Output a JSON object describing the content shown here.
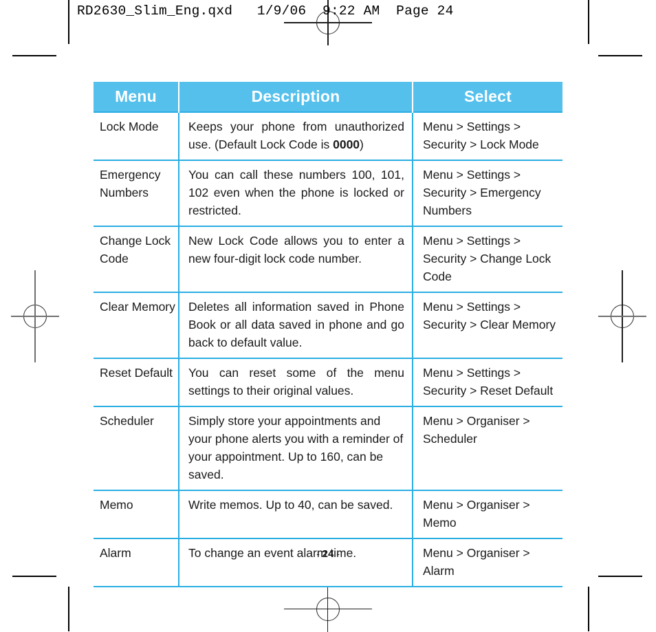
{
  "document": {
    "file_info": "RD2630_Slim_Eng.qxd   1/9/06  9:22 AM  Page 24",
    "page_footer_prefix": "-",
    "page_number": "24",
    "page_footer_suffix": "-"
  },
  "colors": {
    "header_fill": "#55c0ec",
    "rule": "#29aee3",
    "header_text": "#ffffff",
    "body_text": "#1a1a1a"
  },
  "table": {
    "headers": [
      "Menu",
      "Description",
      "Select"
    ],
    "rows": [
      {
        "menu": "Lock Mode",
        "description_prefix": "Keeps your phone from unauthorized use. (Default Lock Code is ",
        "description_bold": "0000",
        "description_suffix": ")",
        "justified": true,
        "select": "Menu > Settings > Security > Lock Mode"
      },
      {
        "menu": "Emergency Numbers",
        "description": "You can call these numbers 100, 101, 102 even when the phone is locked or restricted.",
        "justified": true,
        "select": "Menu > Settings > Security > Emergency Numbers"
      },
      {
        "menu": "Change Lock Code",
        "description": "New Lock Code allows you to enter a new four-digit lock code number.",
        "justified": true,
        "select": "Menu > Settings > Security > Change Lock Code"
      },
      {
        "menu": "Clear Memory",
        "description": "Deletes all information saved in Phone Book or all data saved in phone and go back to default value.",
        "justified": true,
        "select": "Menu > Settings > Security > Clear Memory"
      },
      {
        "menu": "Reset Default",
        "description": "You can reset some of the menu settings to their original values.",
        "justified": true,
        "select": "Menu > Settings > Security > Reset Default"
      },
      {
        "menu": "Scheduler",
        "description": "Simply store your appointments and your phone alerts you with a reminder of your appointment. Up to 160, can be saved.",
        "justified": false,
        "select": "Menu > Organiser > Scheduler"
      },
      {
        "menu": "Memo",
        "description": "Write memos. Up to 40, can be saved.",
        "justified": false,
        "select": "Menu > Organiser > Memo"
      },
      {
        "menu": "Alarm",
        "description": "To change an event alarm time.",
        "justified": false,
        "select": "Menu > Organiser > Alarm"
      }
    ]
  }
}
